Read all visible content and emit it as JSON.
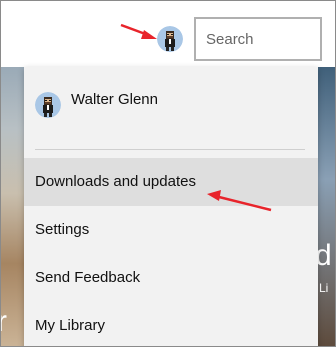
{
  "header": {
    "search": {
      "placeholder": "Search",
      "value": ""
    },
    "account_icon": "user-avatar-icon"
  },
  "account_menu": {
    "user_name": "Walter Glenn",
    "items": [
      {
        "label": "Downloads and updates",
        "highlighted": true
      },
      {
        "label": "Settings",
        "highlighted": false
      },
      {
        "label": "Send Feedback",
        "highlighted": false
      },
      {
        "label": "My Library",
        "highlighted": false
      }
    ]
  },
  "background": {
    "left_text": "r",
    "right_text": "d",
    "right_small_text": "Li"
  },
  "annotations": {
    "arrow_color": "#e8242b"
  }
}
